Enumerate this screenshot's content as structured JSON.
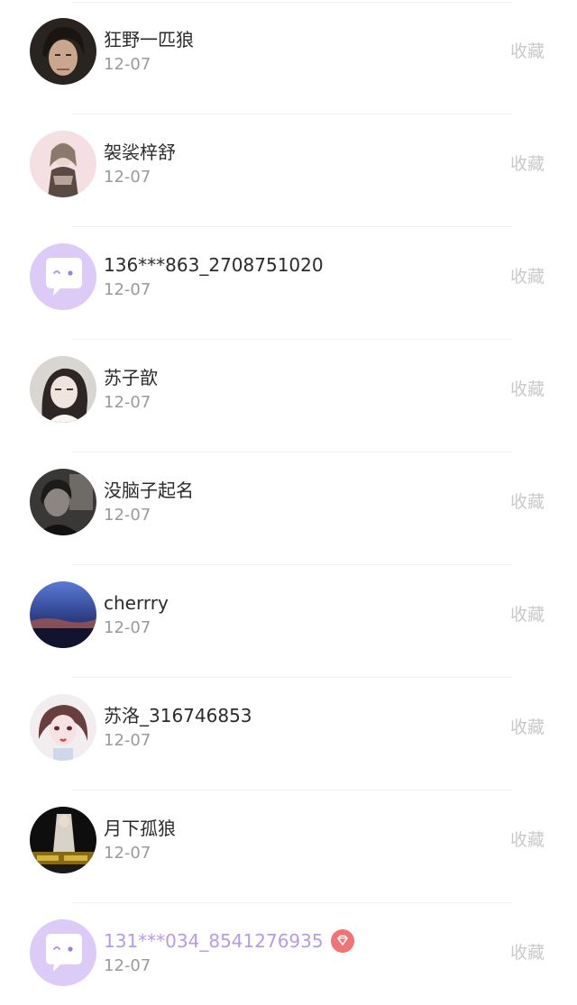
{
  "collect_label": "收藏",
  "items": [
    {
      "name": "狂野一匹狼",
      "date": "12-07"
    },
    {
      "name": "袈裟梓舒",
      "date": "12-07"
    },
    {
      "name": "136***863_2708751020",
      "date": "12-07"
    },
    {
      "name": "苏子歆",
      "date": "12-07"
    },
    {
      "name": "没脑子起名",
      "date": "12-07"
    },
    {
      "name": "cherrry",
      "date": "12-07"
    },
    {
      "name": "苏洛_316746853",
      "date": "12-07"
    },
    {
      "name": "月下孤狼",
      "date": "12-07"
    },
    {
      "name": "131***034_8541276935",
      "date": "12-07",
      "vip": true
    }
  ],
  "colors": {
    "default_avatar_bg": "#dccaf7",
    "vip_name": "#b79be8",
    "vip_badge": "#f07474"
  }
}
